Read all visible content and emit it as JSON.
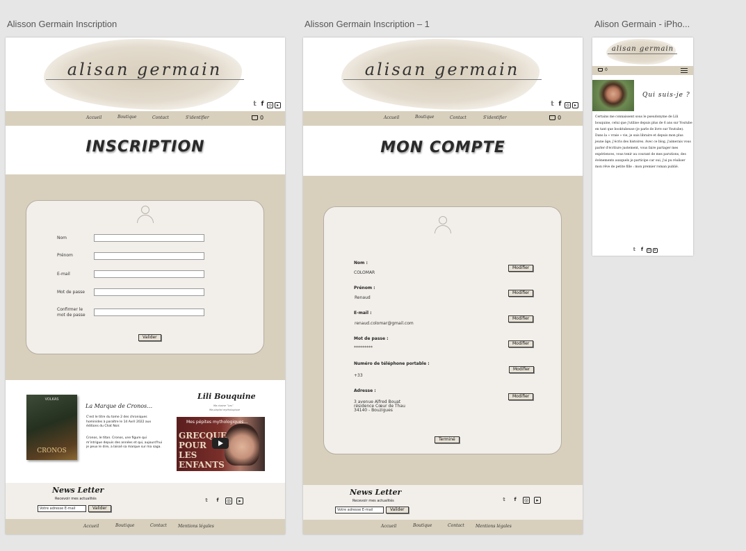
{
  "artboards": {
    "a1": "Alisson Germain Inscription",
    "a2": "Alisson Germain Inscription – 1",
    "a3": "Alison Germain - iPho..."
  },
  "brand": {
    "logo": "alisan germain"
  },
  "nav": {
    "home": "Accueil",
    "shop": "Boutique",
    "contact": "Contact",
    "login": "S'identifier",
    "cart_count": "0",
    "legal": "Mentions légales"
  },
  "social_icons": [
    "twitter-icon",
    "facebook-icon",
    "instagram-icon",
    "youtube-icon"
  ],
  "inscription": {
    "title": "INSCRIPTION",
    "fields": {
      "nom": "Nom",
      "prenom": "Prénom",
      "email": "E-mail",
      "password": "Mot de passe",
      "confirm": "Confirmer le mot de passe"
    },
    "submit": "Valider"
  },
  "promo": {
    "book_author": "VOLKAS",
    "book_title": "CRONOS",
    "title": "La Marque de Cronos…",
    "text1": "C'est le titre du tome 2 des chroniques hominides à paraître le 14 Avril 2022 aux éditions du Chat Noir.",
    "text2": "Cronos, le titan. Cronos, une figure qui m'intrigue depuis des années et qui, aujourd'hui je peux le dire, a laissé sa marque sur ma saga.",
    "yt_title": "Lili Bouquine",
    "yt_sub1": "Ma chaine ”Les”",
    "yt_sub2": "Ma playlist mythologique",
    "video_caption": "Mes pépites mythologiques...",
    "video_big": "GRECQUE POUR LES ENFANTS"
  },
  "newsletter": {
    "title": "News Letter",
    "subtitle": "Recevoir mes actualités",
    "placeholder": "Votre adresse E-mail",
    "button": "Valider"
  },
  "compte": {
    "title": "MON COMPTE",
    "rows": [
      {
        "label": "Nom :",
        "value": "COLOMAR"
      },
      {
        "label": "Prénom :",
        "value": "Renaud"
      },
      {
        "label": "E-mail :",
        "value": "renaud.colomar@gmail.com"
      },
      {
        "label": "Mot de passe :",
        "value": "*********"
      },
      {
        "label": "Numéro de téléphone portable :",
        "value": "+33"
      },
      {
        "label": "Adresse :",
        "value": "3 avenue Alfred Bouat\nrésidence Cœur de Thau\n34140 - Bouzigues"
      }
    ],
    "modify": "Modifier",
    "done": "Terminé"
  },
  "phone": {
    "cart_count": "0",
    "title": "Qui suis-je ?",
    "text": "Certains me connaissent sous le pseudonyme de Lili bouquine, celui que j'utilise depuis plus de 6 ans sur Youtube en tant que booktubeuse (je parle de livre sur Youtube). Dans la « vraie » vie, je suis libraire et depuis mon plus jeune âge, j'écris des histoires. Avec ce blog, j'aimerais vous parler d'écriture justement, vous faire partager mes expériences, vous tenir au courant de mes parutions, des événements auxquels je participe car oui, j'ai pu réaliser mon rêve de petite fille : mon premier roman publié."
  }
}
